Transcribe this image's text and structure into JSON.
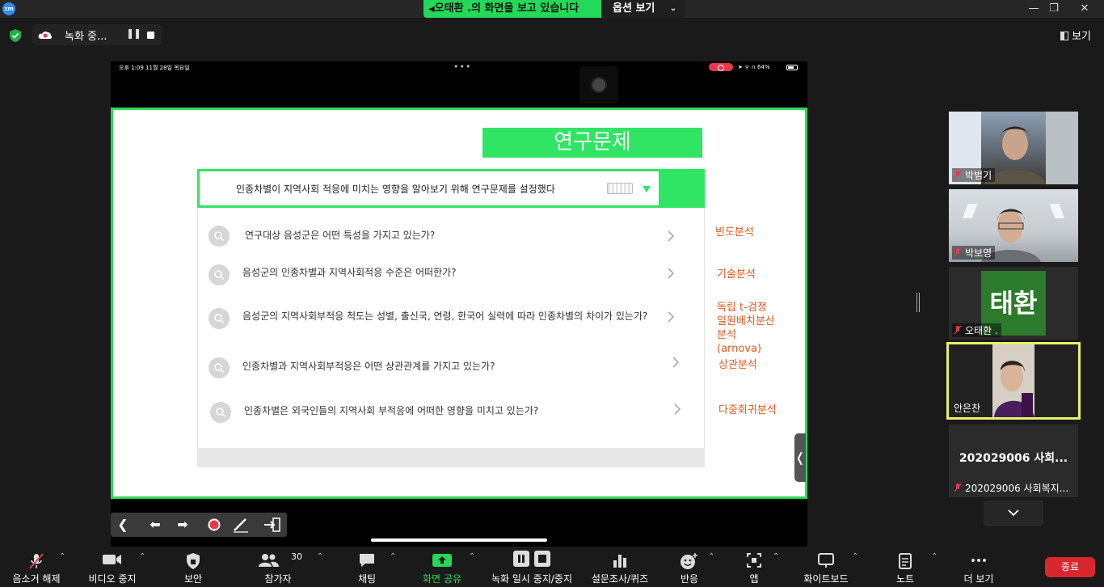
{
  "titlebar": {
    "app_logo": "zm",
    "share_banner": "오태환 .의 화면을 보고 있습니다",
    "view_options": "옵션 보기",
    "window_buttons": [
      "—",
      "❐",
      "✕"
    ]
  },
  "secbar": {
    "recording_label": "녹화 중...",
    "pause_glyph": "❚❚",
    "view_label": "보기"
  },
  "ipad": {
    "status_left": "오후 1:09   11월 28일 목요일",
    "dots": "•••",
    "status_right": "➤ ᯤ ∩ 64%"
  },
  "slide": {
    "title": "연구문제",
    "question": "인종차별이 지역사회 적응에 미치는 영향을 알아보기 위해 연구문제를 설정했다",
    "items": [
      {
        "text": "연구대상 음성군은 어떤 특성을 가지고 있는가?",
        "method": "빈도분석"
      },
      {
        "text": "음성군의 인종차별과 지역사회적응 수준은 어떠한가?",
        "method": "기술분석"
      },
      {
        "text": "음성군의 지역사회부적응 척도는 성별, 출신국, 연령, 한국어 실력에 따라 인종차별의 차이가 있는가?",
        "method": "독립 t-검정 일원배치분산분석 (arnova)"
      },
      {
        "text": "인종차별과 지역사회부적응은 어떤 상관관계를 가지고 있는가?",
        "method": "상관분석"
      },
      {
        "text": "인종차별은 외국인들의 지역사회 부적응에 어떠한 영향을 미치고 있는가?",
        "method": "다중회귀분석"
      }
    ],
    "pull_tab": "❬"
  },
  "annotation_toolbar": {
    "collapse": "❮",
    "back": "⬅",
    "forward": "➡"
  },
  "gallery": {
    "participants": [
      {
        "name": "박범기",
        "muted": true
      },
      {
        "name": "박보영",
        "muted": true
      },
      {
        "name": "오태환 .",
        "muted": true,
        "avatar_text": "태환"
      },
      {
        "name": "안은찬",
        "muted": false
      },
      {
        "name": "202029006 사회복지...",
        "muted": true,
        "headline": "202029006 사회..."
      }
    ]
  },
  "controls": {
    "items": [
      {
        "label": "음소거 해제",
        "icon": "mic-muted-icon"
      },
      {
        "label": "비디오 중지",
        "icon": "video-camera-icon"
      },
      {
        "label": "보안",
        "icon": "security-shield-icon"
      },
      {
        "label": "참가자",
        "icon": "participants-icon",
        "count": "30"
      },
      {
        "label": "채팅",
        "icon": "chat-icon"
      },
      {
        "label": "화면 공유",
        "icon": "share-screen-icon"
      },
      {
        "label": "녹화 일시 중지/중지",
        "icon": "record-pause-stop-icon"
      },
      {
        "label": "설문조사/퀴즈",
        "icon": "poll-icon"
      },
      {
        "label": "반응",
        "icon": "reactions-icon"
      },
      {
        "label": "앱",
        "icon": "apps-icon"
      },
      {
        "label": "화이트보드",
        "icon": "whiteboard-icon"
      },
      {
        "label": "노트",
        "icon": "notes-icon"
      },
      {
        "label": "더 보기",
        "icon": "more-icon"
      }
    ],
    "end_label": "종료"
  },
  "colors": {
    "share_green": "#23d959",
    "slide_green": "#30e464",
    "method_orange": "#e0581e",
    "active_speaker": "#e6f06e",
    "end_red": "#d9272e"
  }
}
